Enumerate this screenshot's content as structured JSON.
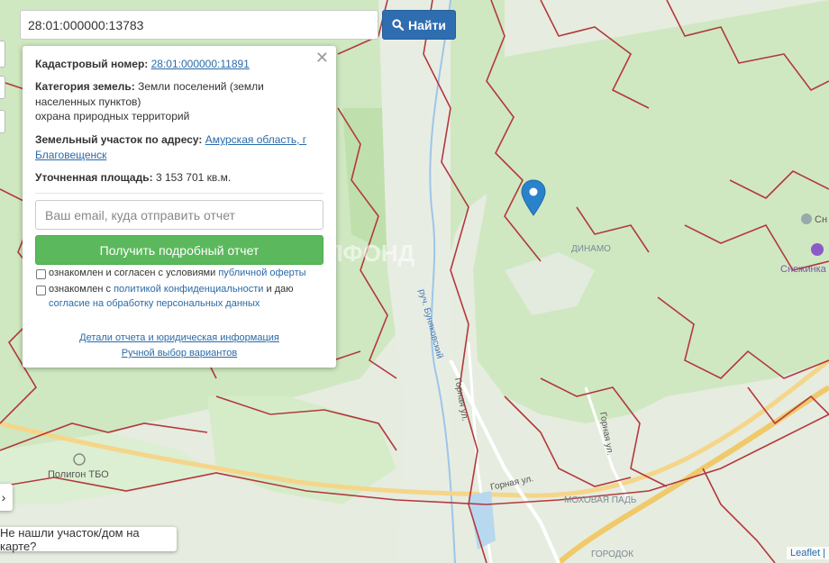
{
  "search": {
    "value": "28:01:000000:13783",
    "button_label": "Найти"
  },
  "popup": {
    "cadastral_label": "Кадастровый номер:",
    "cadastral_value": "28:01:000000:11891",
    "category_label": "Категория земель:",
    "category_value": "Земли поселений (земли населенных пунктов)",
    "category_extra": "охрана природных территорий",
    "address_label": "Земельный участок по адресу:",
    "address_value": "Амурская область, г Благовещенск",
    "area_label": "Уточненная площадь:",
    "area_value": "3 153 701 кв.м.",
    "email_placeholder": "Ваш email, куда отправить отчет",
    "report_button": "Получить подробный отчет",
    "consent1_prefix": "ознакомлен и согласен с условиями",
    "consent1_link": "публичной оферты",
    "consent2_prefix": "ознакомлен с",
    "consent2_link": "политикой конфиденциальности",
    "consent2_middle": "и даю",
    "consent2_link2": "согласие на обработку персональных данных",
    "details_link": "Детали отчета и юридическая информация",
    "manual_link": "Ручной выбор вариантов"
  },
  "map": {
    "label_dinamo": "ДИНАМО",
    "label_poligon": "Полигон ТБО",
    "label_stream": "руч. Буняковский",
    "label_gornaya1": "Горная ул.",
    "label_gornaya2": "Горная ул.",
    "label_gornaya3": "Горная ул.",
    "label_mokhovaya": "МОХОВАЯ ПАДЬ",
    "label_gorodok": "ГОРОДОК",
    "label_snezh": "Снежинка",
    "label_snezh_short": "Сн",
    "watermark": "ЖИЛФОНД"
  },
  "not_found": "Не нашли участок/дом на карте?",
  "attribution": "Leaflet |",
  "colors": {
    "boundary": "#b3383d",
    "forest": "#cfe8c1",
    "primary": "#2f6db1",
    "success": "#5cb85c"
  }
}
